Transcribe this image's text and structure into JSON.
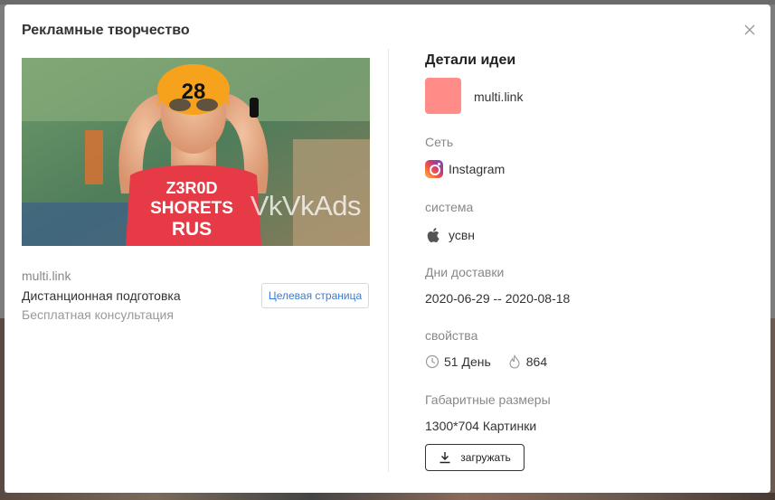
{
  "modal": {
    "title": "Рекламные творчество",
    "close_icon": "close-icon"
  },
  "creative": {
    "bib_number": "28",
    "jersey_line1": "Z3R0D",
    "jersey_line2": "SHORETS",
    "jersey_line3": "RUS",
    "watermark": "VkVkAds",
    "domain": "multi.link",
    "headline": "Дистанционная подготовка",
    "description": "Бесплатная консультация",
    "landing_button": "Целевая страница"
  },
  "details": {
    "title": "Детали идеи",
    "advertiser": {
      "name": "multi.link",
      "logo_color": "#ff8c87"
    },
    "network": {
      "label": "Сеть",
      "value": "Instagram",
      "icon": "instagram-icon"
    },
    "system": {
      "label": "система",
      "value": "усвн",
      "icon": "apple-icon"
    },
    "delivery_days": {
      "label": "Дни доставки",
      "value": "2020-06-29 -- 2020-08-18"
    },
    "properties": {
      "label": "свойства",
      "duration": "51 День",
      "duration_icon": "clock-icon",
      "heat": "864",
      "heat_icon": "flame-icon"
    },
    "dimensions": {
      "label": "Габаритные размеры",
      "value": "1300*704 Картинки"
    },
    "download_button": "загружать"
  }
}
